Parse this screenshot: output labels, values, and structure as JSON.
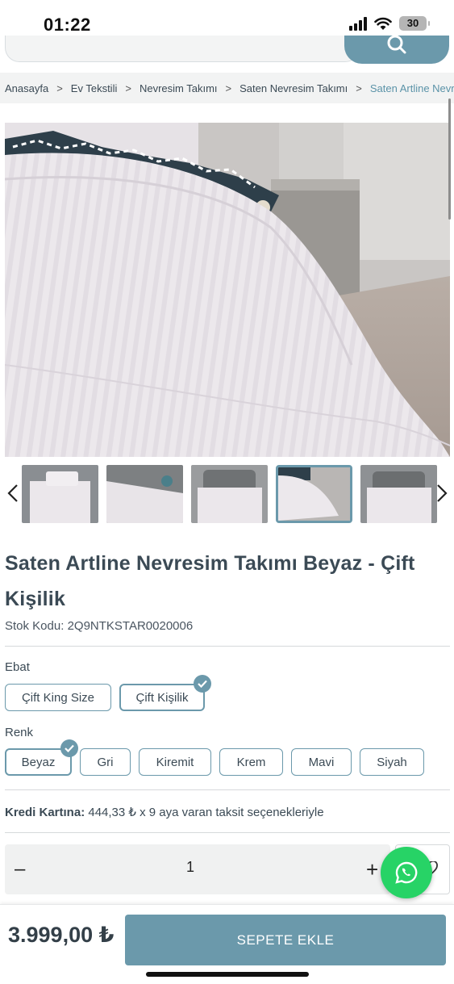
{
  "status_bar": {
    "time": "01:22",
    "battery": "30",
    "icons": [
      "signal-icon",
      "wifi-icon",
      "battery-icon"
    ]
  },
  "search": {
    "placeholder": "",
    "button_icon": "search-icon"
  },
  "breadcrumb": {
    "items": [
      "Anasayfa",
      "Ev Tekstili",
      "Nevresim Takımı",
      "Saten Nevresim Takımı",
      "Saten Artline Nevr"
    ],
    "separator": ">"
  },
  "gallery": {
    "main_image_alt": "product-photo",
    "thumbnail_count": 5,
    "selected_thumbnail": 4,
    "prev_icon": "chevron-left-icon",
    "next_icon": "chevron-right-icon"
  },
  "product": {
    "title": "Saten Artline Nevresim Takımı Beyaz - Çift Kişilik",
    "stock_label": "Stok Kodu:",
    "stock_code": "2Q9NTKSTAR0020006"
  },
  "options": {
    "size": {
      "label": "Ebat",
      "choices": [
        "Çift King Size",
        "Çift Kişilik"
      ],
      "selected": "Çift Kişilik"
    },
    "color": {
      "label": "Renk",
      "choices": [
        "Beyaz",
        "Gri",
        "Kiremit",
        "Krem",
        "Mavi",
        "Siyah"
      ],
      "selected": "Beyaz"
    }
  },
  "installment": {
    "label": "Kredi Kartına:",
    "text": "444,33 ₺ x 9 aya varan taksit seçenekleriyle"
  },
  "quantity": {
    "minus": "–",
    "value": "1",
    "plus": "+"
  },
  "favorite_icon": "heart-icon",
  "whatsapp_icon": "whatsapp-icon",
  "bottom_bar": {
    "price": "3.999,00 ₺",
    "add_to_cart": "SEPETE EKLE"
  },
  "colors": {
    "accent": "#6b99ab",
    "whatsapp": "#27d366",
    "text": "#3b4a55"
  }
}
